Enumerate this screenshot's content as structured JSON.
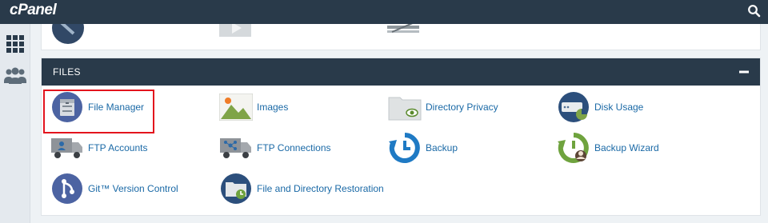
{
  "header": {
    "logo": "cPanel",
    "search_icon": "search-icon"
  },
  "sidebar": {
    "items": [
      {
        "name": "tools",
        "icon": "grid-icon"
      },
      {
        "name": "users",
        "icon": "users-icon"
      }
    ]
  },
  "files_panel": {
    "title": "FILES",
    "collapse_icon": "minus-icon",
    "items": [
      {
        "label": "File Manager",
        "icon": "file-manager-icon"
      },
      {
        "label": "Images",
        "icon": "images-icon"
      },
      {
        "label": "Directory Privacy",
        "icon": "directory-privacy-icon"
      },
      {
        "label": "Disk Usage",
        "icon": "disk-usage-icon"
      },
      {
        "label": "FTP Accounts",
        "icon": "ftp-accounts-icon"
      },
      {
        "label": "FTP Connections",
        "icon": "ftp-connections-icon"
      },
      {
        "label": "Backup",
        "icon": "backup-icon"
      },
      {
        "label": "Backup Wizard",
        "icon": "backup-wizard-icon"
      },
      {
        "label": "Git™ Version Control",
        "icon": "git-icon"
      },
      {
        "label": "File and Directory Restoration",
        "icon": "file-restoration-icon"
      }
    ]
  },
  "colors": {
    "header_bg": "#293a4a",
    "link": "#1a69a6",
    "highlight": "#e3141d"
  }
}
